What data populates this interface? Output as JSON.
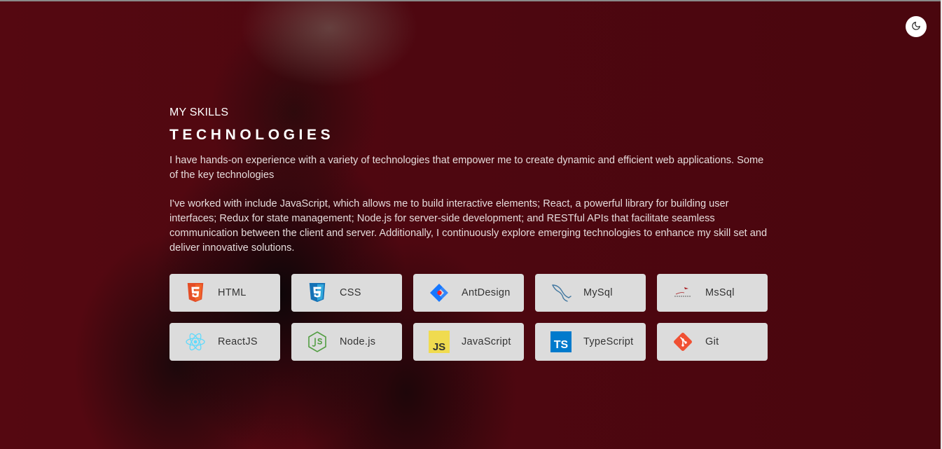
{
  "header": {
    "theme_toggle_icon": "moon-icon"
  },
  "skills": {
    "eyebrow": "MY SKILLS",
    "title": "TECHNOLOGIES",
    "paragraph1": "I have hands-on experience with a variety of technologies that empower me to create dynamic and efficient web applications. Some of the key technologies",
    "paragraph2": "I've worked with include JavaScript, which allows me to build interactive elements; React, a powerful library for building user interfaces; Redux for state management; Node.js for server-side development; and RESTful APIs that facilitate seamless communication between the client and server. Additionally, I continuously explore emerging technologies to enhance my skill set and deliver innovative solutions."
  },
  "technologies": [
    {
      "label": "HTML",
      "icon": "html5-icon",
      "color": "#e44d26"
    },
    {
      "label": "CSS",
      "icon": "css3-icon",
      "color": "#1572b6"
    },
    {
      "label": "AntDesign",
      "icon": "antdesign-icon",
      "color": "#1677ff"
    },
    {
      "label": "MySql",
      "icon": "mysql-dolphin-icon",
      "color": "#4479a1"
    },
    {
      "label": "MsSql",
      "icon": "mssql-icon",
      "color": "#a91d22"
    },
    {
      "label": "ReactJS",
      "icon": "react-icon",
      "color": "#61dafb"
    },
    {
      "label": "Node.js",
      "icon": "nodejs-icon",
      "color": "#539e43"
    },
    {
      "label": "JavaScript",
      "icon": "javascript-icon",
      "color": "#f0db4f"
    },
    {
      "label": "TypeScript",
      "icon": "typescript-icon",
      "color": "#007acc"
    },
    {
      "label": "Git",
      "icon": "git-icon",
      "color": "#f05033"
    }
  ]
}
